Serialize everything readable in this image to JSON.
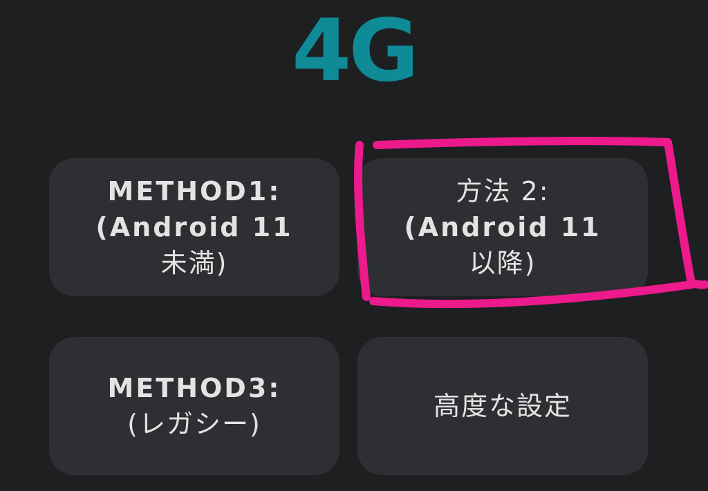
{
  "logo": {
    "text": "4G",
    "color": "#0e8b96"
  },
  "options": [
    {
      "line1": "METHOD1:",
      "line2": "(Android 11",
      "line3": "未満)"
    },
    {
      "line1": "方法 2:",
      "line2": "(Android 11",
      "line3": "以降)"
    },
    {
      "line1": "METHOD3:",
      "line2": "(レガシー)"
    },
    {
      "line1": "高度な設定"
    }
  ],
  "colors": {
    "background": "#1e1f21",
    "card": "#2e2f32",
    "card_text": "#e3e3e3",
    "annotation": "#ec1a8c"
  },
  "annotation": {
    "target": "method-2",
    "shape": "hand-drawn rectangle"
  }
}
